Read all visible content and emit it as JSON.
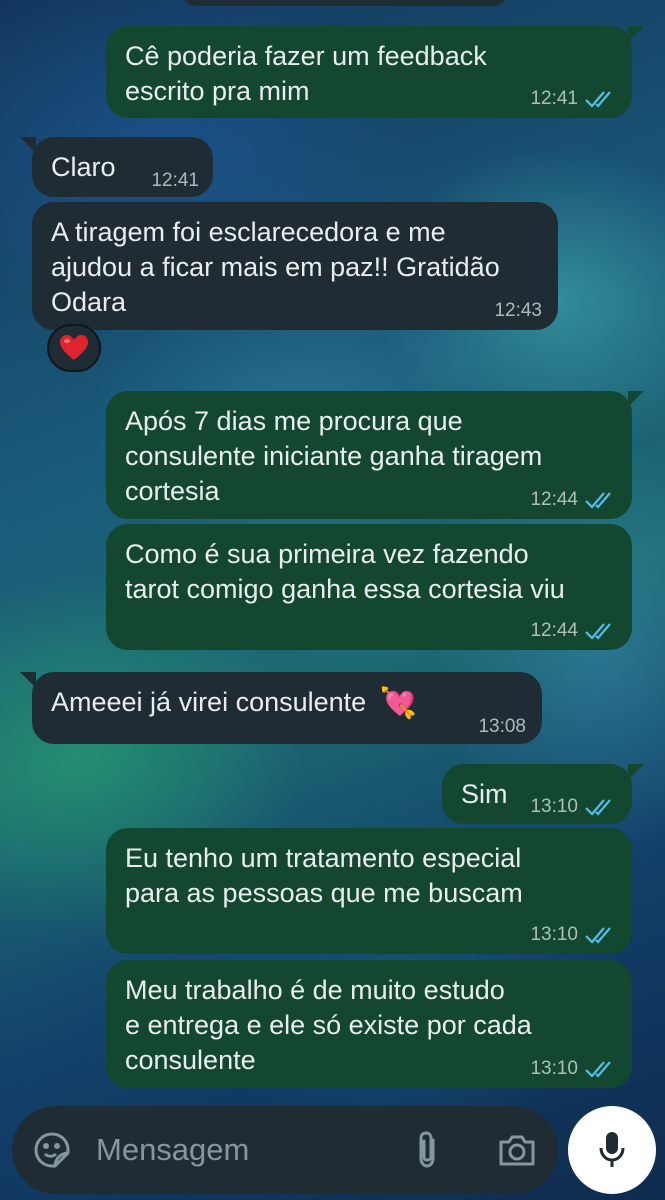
{
  "messages": [
    {
      "direction": "out",
      "text": "Cê poderia fazer um feedback\nescrito pra mim",
      "time": "12:41",
      "status": "read"
    },
    {
      "direction": "in",
      "text": "Claro",
      "time": "12:41"
    },
    {
      "direction": "in",
      "text": "A tiragem foi esclarecedora e me\najudou a ficar mais em paz!! Gratidão\nOdara",
      "time": "12:43",
      "reaction": "❤️"
    },
    {
      "direction": "out",
      "text": "Após 7 dias me procura que\nconsulente iniciante ganha tiragem\ncortesia",
      "time": "12:44",
      "status": "read"
    },
    {
      "direction": "out",
      "text": "Como é sua primeira vez fazendo\ntarot comigo ganha essa cortesia viu",
      "time": "12:44",
      "status": "read"
    },
    {
      "direction": "in",
      "text": "Ameeei já virei consulente",
      "emoji": "💘",
      "time": "13:08"
    },
    {
      "direction": "out",
      "text": "Sim",
      "time": "13:10",
      "status": "read"
    },
    {
      "direction": "out",
      "text": "Eu tenho um tratamento especial\npara as pessoas que me buscam",
      "time": "13:10",
      "status": "read"
    },
    {
      "direction": "out",
      "text": "Meu trabalho é de muito estudo\ne entrega e ele só existe por cada\nconsulente",
      "time": "13:10",
      "status": "read"
    }
  ],
  "composer": {
    "placeholder": "Mensagem",
    "icons": [
      "sticker-icon",
      "attach-icon",
      "camera-icon",
      "mic-icon"
    ]
  },
  "colors": {
    "outgoing_bubble": "#13472f",
    "incoming_bubble": "#1f2c34",
    "read_ticks": "#53bdeb",
    "text": "#e9edef",
    "meta_text": "#8696a0"
  }
}
